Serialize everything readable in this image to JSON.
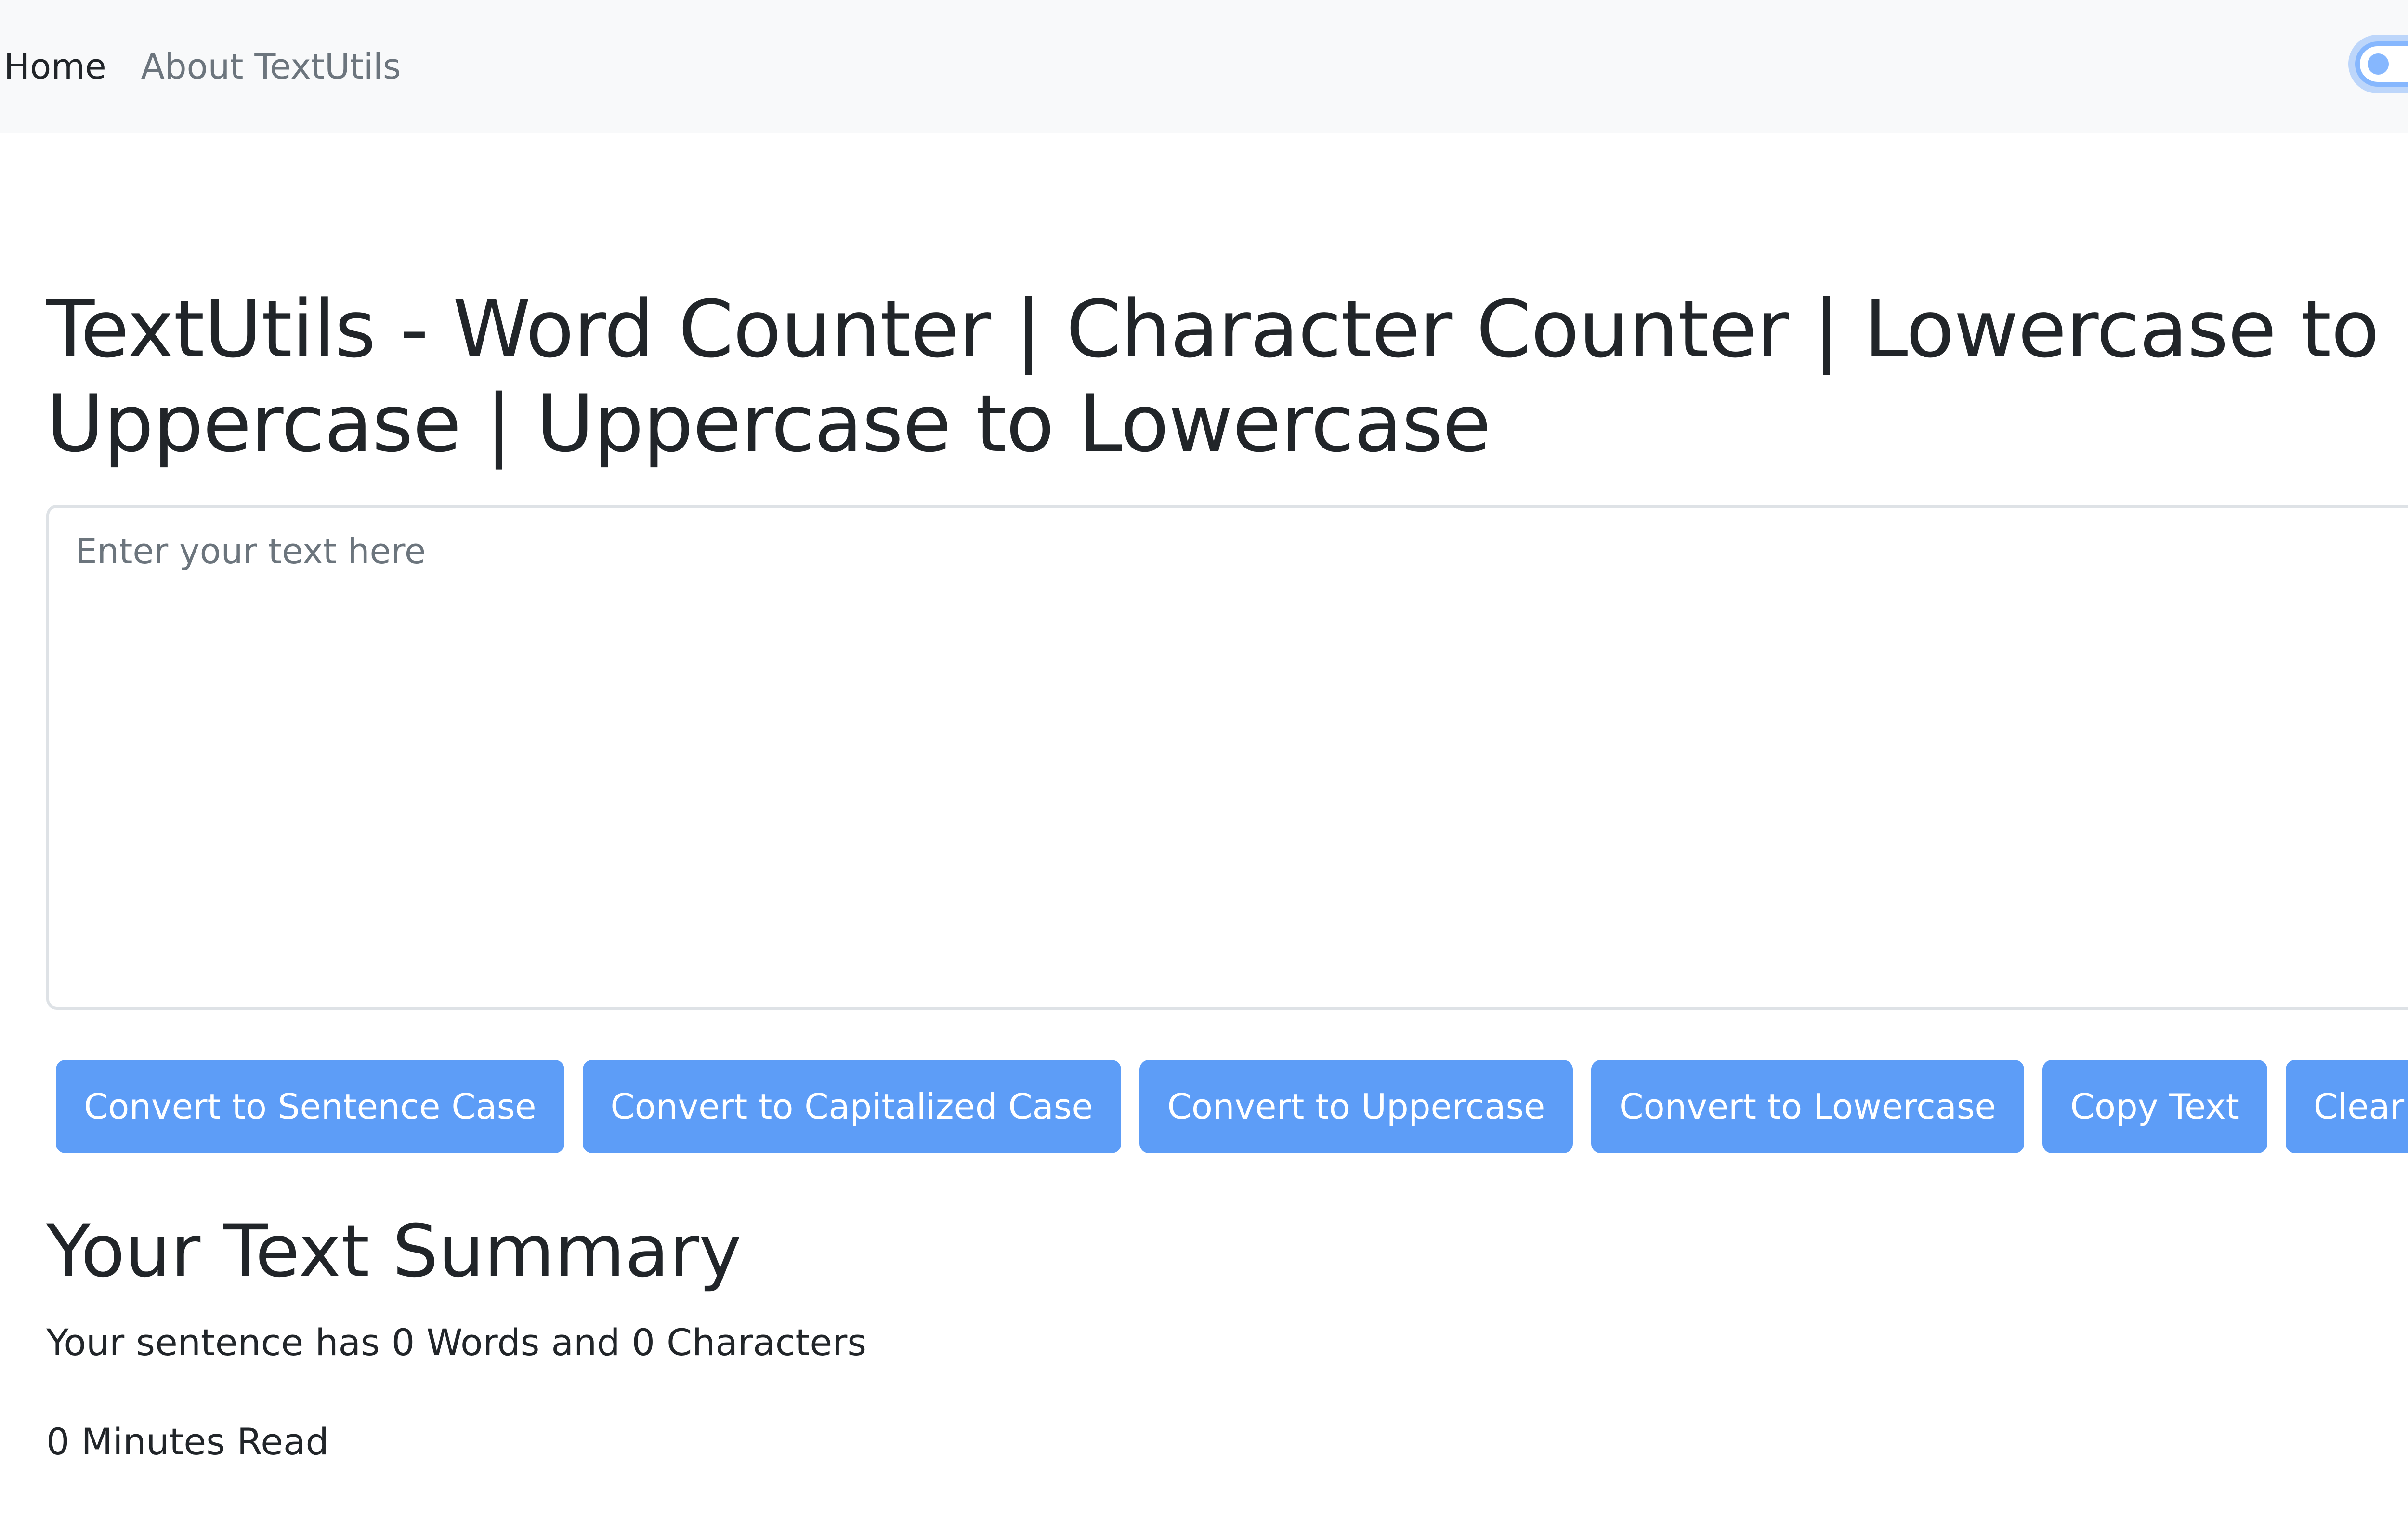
{
  "nav": {
    "home": "Home",
    "about": "About TextUtils"
  },
  "theme_toggle": {
    "state": "off"
  },
  "main": {
    "title": "TextUtils - Word Counter | Character Counter | Lowercase to Uppercase | Uppercase to Lowercase",
    "textarea": {
      "placeholder": "Enter your text here",
      "value": ""
    },
    "buttons": {
      "sentence_case": "Convert to Sentence Case",
      "capitalized_case": "Convert to Capitalized Case",
      "uppercase": "Convert to Uppercase",
      "lowercase": "Convert to Lowercase",
      "copy": "Copy Text",
      "clear": "Clear Text"
    }
  },
  "summary": {
    "title": "Your Text Summary",
    "counts": "Your sentence has 0 Words and 0 Characters",
    "read_time": "0 Minutes Read"
  },
  "colors": {
    "button": "#5d9df7",
    "navbar": "#f8f9fa",
    "toggle": "#86b7fe"
  }
}
